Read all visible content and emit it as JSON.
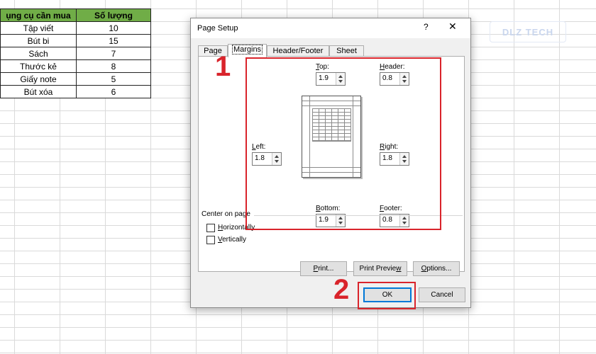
{
  "sheet": {
    "headers": [
      "ụng cụ cần mua",
      "Số lượng"
    ],
    "rows": [
      {
        "item": "Tập viết",
        "qty": "10"
      },
      {
        "item": "Bút bi",
        "qty": "15"
      },
      {
        "item": "Sách",
        "qty": "7"
      },
      {
        "item": "Thước kẻ",
        "qty": "8"
      },
      {
        "item": "Giấy note",
        "qty": "5"
      },
      {
        "item": "Bút xóa",
        "qty": "6"
      }
    ],
    "header_color": "#70ad47"
  },
  "watermark": "DLZ TECH",
  "dialog": {
    "title": "Page Setup",
    "help": "?",
    "close": "✕",
    "tabs": [
      "Page",
      "Margins",
      "Header/Footer",
      "Sheet"
    ],
    "active_tab": "Margins",
    "margins": {
      "top": {
        "label_key": "T",
        "label_rest": "op:",
        "value": "1.9"
      },
      "header": {
        "label_key": "H",
        "label_rest": "eader:",
        "value": "0.8"
      },
      "left": {
        "label_key": "L",
        "label_rest": "eft:",
        "value": "1.8"
      },
      "right": {
        "label_key": "R",
        "label_rest": "ight:",
        "value": "1.8"
      },
      "bottom": {
        "label_key": "B",
        "label_rest": "ottom:",
        "value": "1.9"
      },
      "footer": {
        "label_key": "F",
        "label_rest": "ooter:",
        "value": "0.8"
      }
    },
    "center_on_page": {
      "label": "Center on page",
      "horizontally_key": "H",
      "horizontally_rest": "orizontally",
      "vertically_key": "V",
      "vertically_rest": "ertically"
    },
    "buttons": {
      "print_key": "P",
      "print_rest": "rint...",
      "print_preview_pre": "Print Previe",
      "print_preview_key": "w",
      "options_key": "O",
      "options_rest": "ptions...",
      "ok": "OK",
      "cancel": "Cancel"
    }
  },
  "annotations": {
    "step1": "1",
    "step2": "2",
    "color": "#d9242b"
  }
}
